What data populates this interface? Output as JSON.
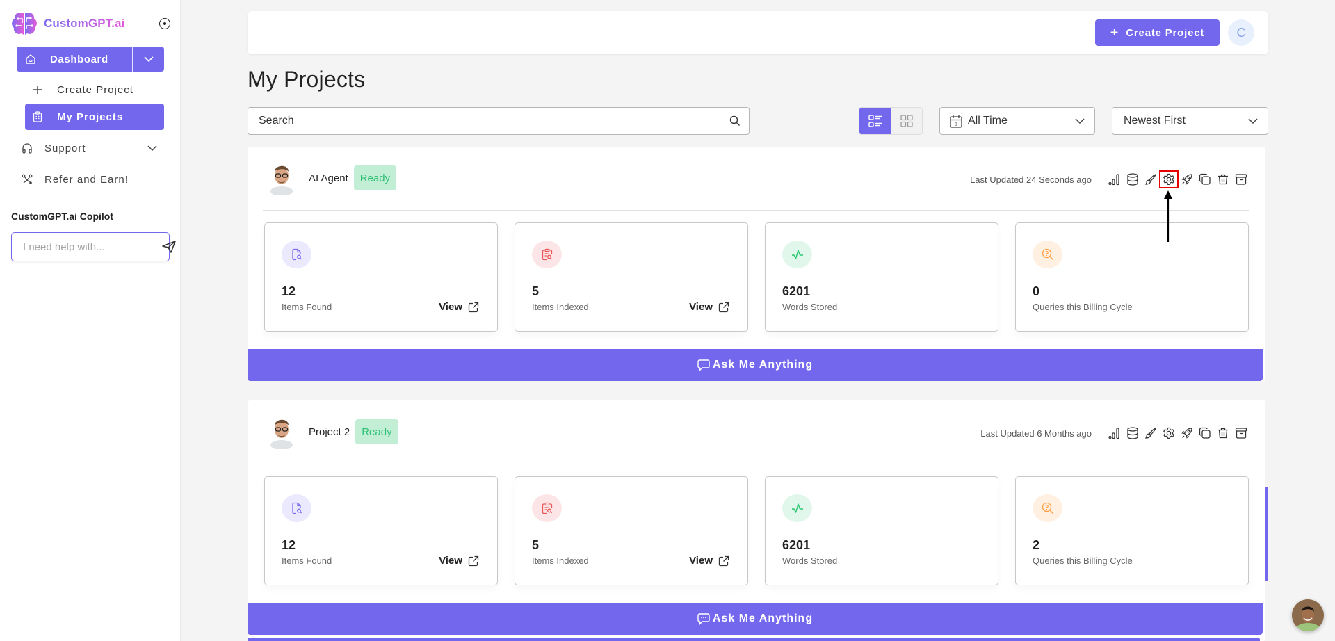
{
  "brand": {
    "name": "CustomGPT.ai",
    "primary_color": "#7367ee"
  },
  "sidebar": {
    "dashboard_label": "Dashboard",
    "create_project_label": "Create Project",
    "my_projects_label": "My Projects",
    "support_label": "Support",
    "refer_label": "Refer and Earn!",
    "copilot_title": "CustomGPT.ai Copilot",
    "copilot_placeholder": "I need help with..."
  },
  "topbar": {
    "create_button_label": "Create Project",
    "user_initial": "C"
  },
  "page": {
    "title": "My Projects",
    "search_placeholder": "Search",
    "time_filter": "All Time",
    "sort_filter": "Newest First",
    "view_mode": "list"
  },
  "projects": [
    {
      "name": "AI Agent",
      "status": "Ready",
      "last_updated": "Last Updated 24 Seconds ago",
      "stats": {
        "items_found": "12",
        "items_found_label": "Items Found",
        "items_indexed": "5",
        "items_indexed_label": "Items Indexed",
        "words_stored": "6201",
        "words_stored_label": "Words Stored",
        "queries": "0",
        "queries_label": "Queries this Billing Cycle",
        "view_label": "View"
      },
      "ask_label": "Ask Me Anything"
    },
    {
      "name": "Project 2",
      "status": "Ready",
      "last_updated": "Last Updated 6 Months ago",
      "stats": {
        "items_found": "12",
        "items_found_label": "Items Found",
        "items_indexed": "5",
        "items_indexed_label": "Items Indexed",
        "words_stored": "6201",
        "words_stored_label": "Words Stored",
        "queries": "2",
        "queries_label": "Queries this Billing Cycle",
        "view_label": "View"
      },
      "ask_label": "Ask Me Anything"
    }
  ],
  "project_actions": [
    "analytics",
    "data-sources",
    "personalize",
    "settings",
    "deploy",
    "duplicate",
    "delete",
    "archive"
  ],
  "annotation": {
    "highlighted_action": "settings"
  }
}
